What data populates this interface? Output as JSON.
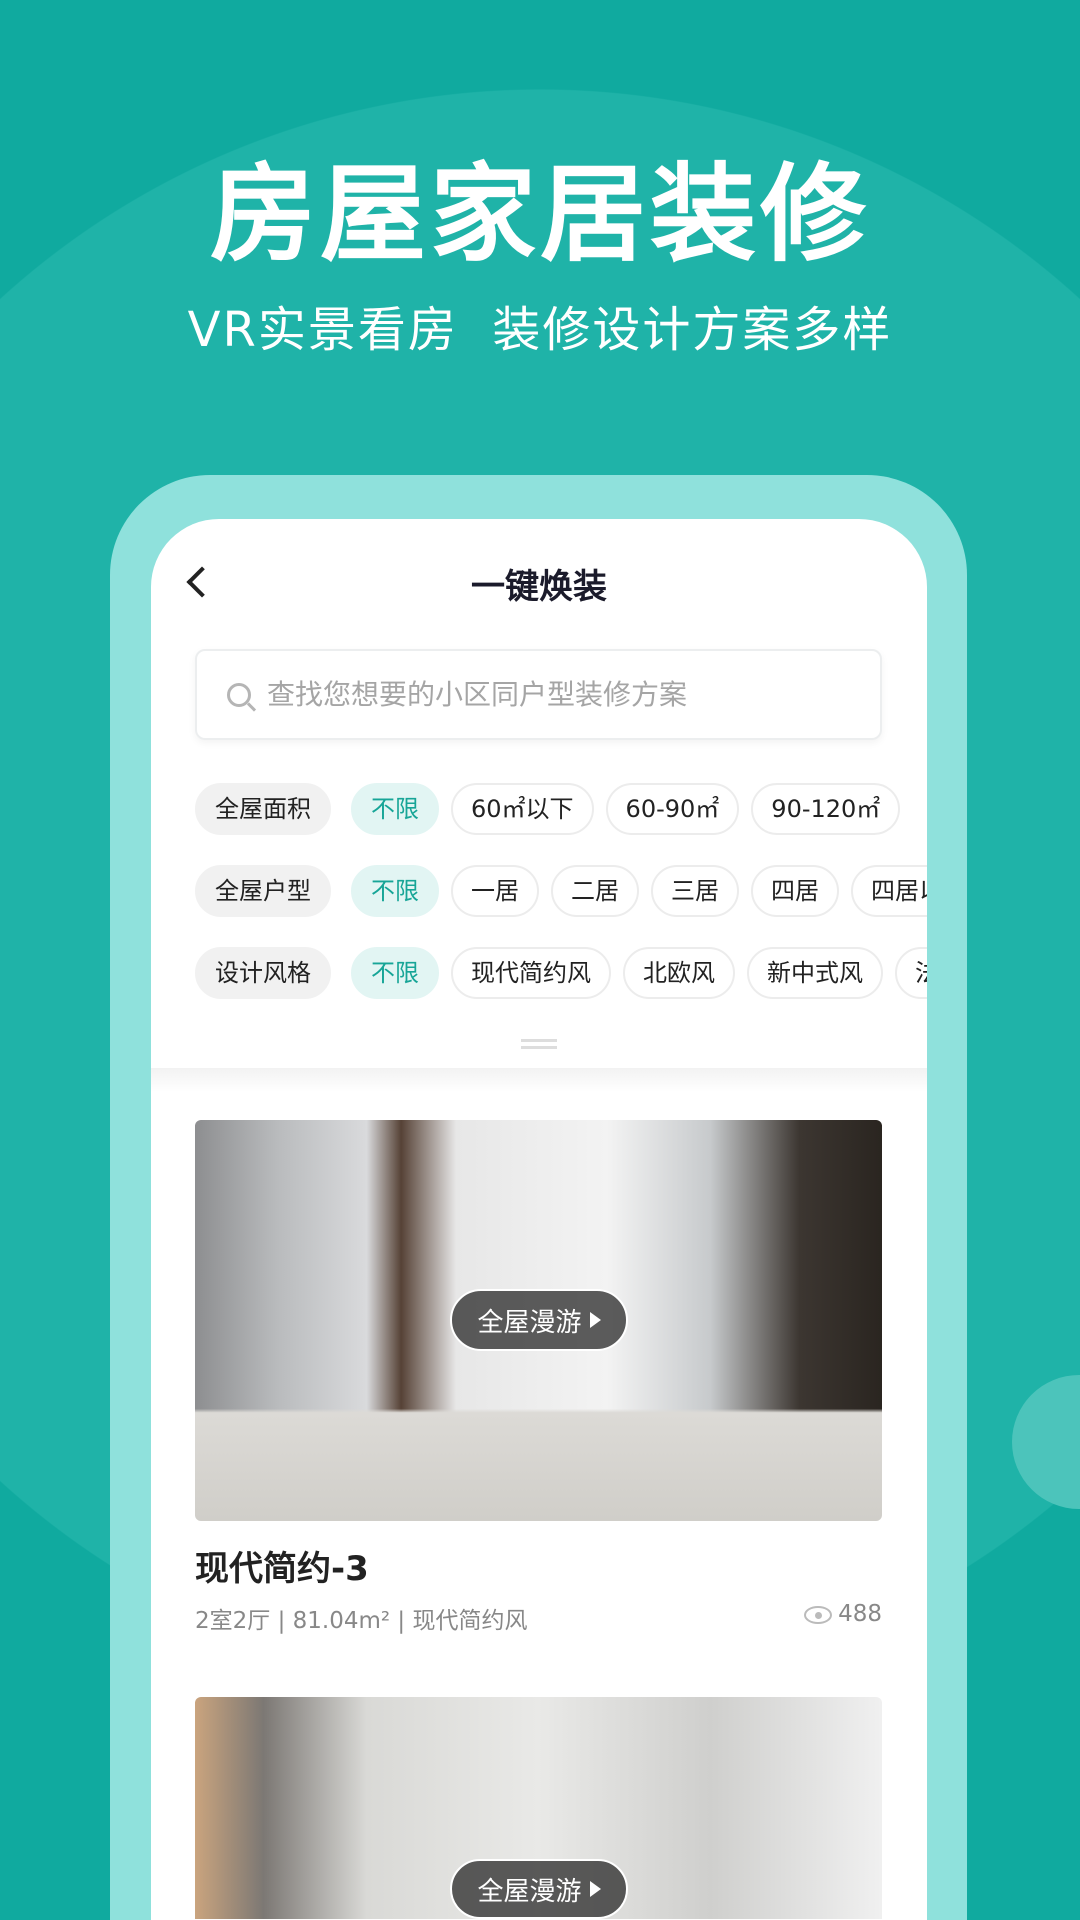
{
  "headline": "房屋家居装修",
  "subheadline": "VR实景看房  装修设计方案多样",
  "app": {
    "title": "一键焕装",
    "search_placeholder": "查找您想要的小区同户型装修方案",
    "filters": [
      {
        "label": "全屋面积",
        "options": [
          "不限",
          "60㎡以下",
          "60-90㎡",
          "90-120㎡"
        ],
        "selected": "不限"
      },
      {
        "label": "全屋户型",
        "options": [
          "不限",
          "一居",
          "二居",
          "三居",
          "四居",
          "四居以上"
        ],
        "selected": "不限"
      },
      {
        "label": "设计风格",
        "options": [
          "不限",
          "现代简约风",
          "北欧风",
          "新中式风",
          "法式风"
        ],
        "selected": "不限"
      }
    ],
    "cards": [
      {
        "tour_label": "全屋漫游",
        "title": "现代简约-3",
        "meta": "2室2厅 | 81.04m² | 现代简约风",
        "views": "488"
      },
      {
        "tour_label": "全屋漫游"
      }
    ]
  },
  "colors": {
    "brand": "#10aa9f",
    "selected_chip_text": "#17a597",
    "frame": "#8fe1dc"
  }
}
